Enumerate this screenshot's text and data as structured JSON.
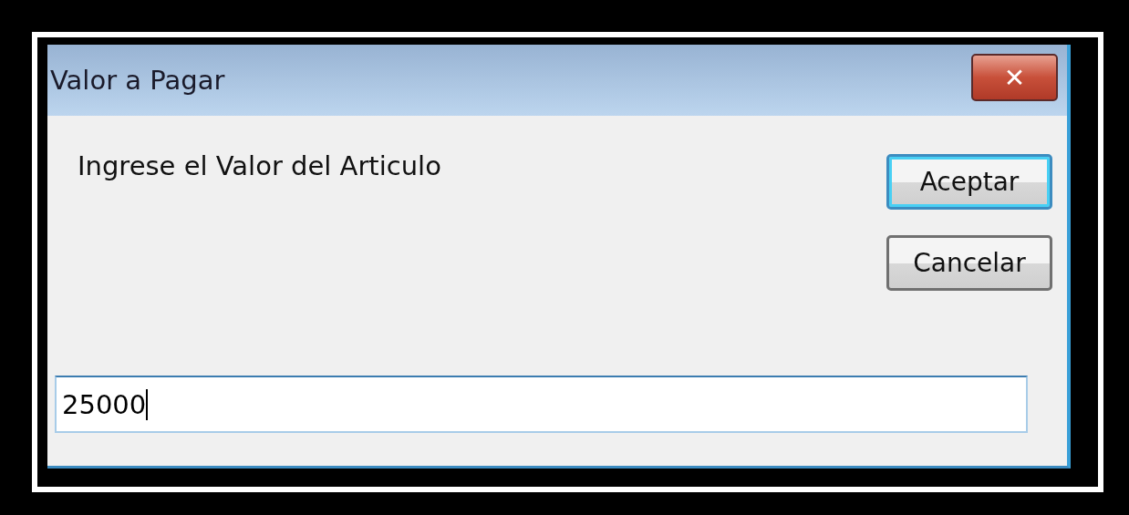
{
  "window": {
    "title": "Valor a Pagar",
    "close_label": "✕"
  },
  "prompt": "Ingrese el Valor del Articulo",
  "buttons": [
    {
      "label": "Aceptar",
      "default": true
    },
    {
      "label": "Cancelar",
      "default": false
    }
  ],
  "input": {
    "value": "25000",
    "focused": true
  }
}
